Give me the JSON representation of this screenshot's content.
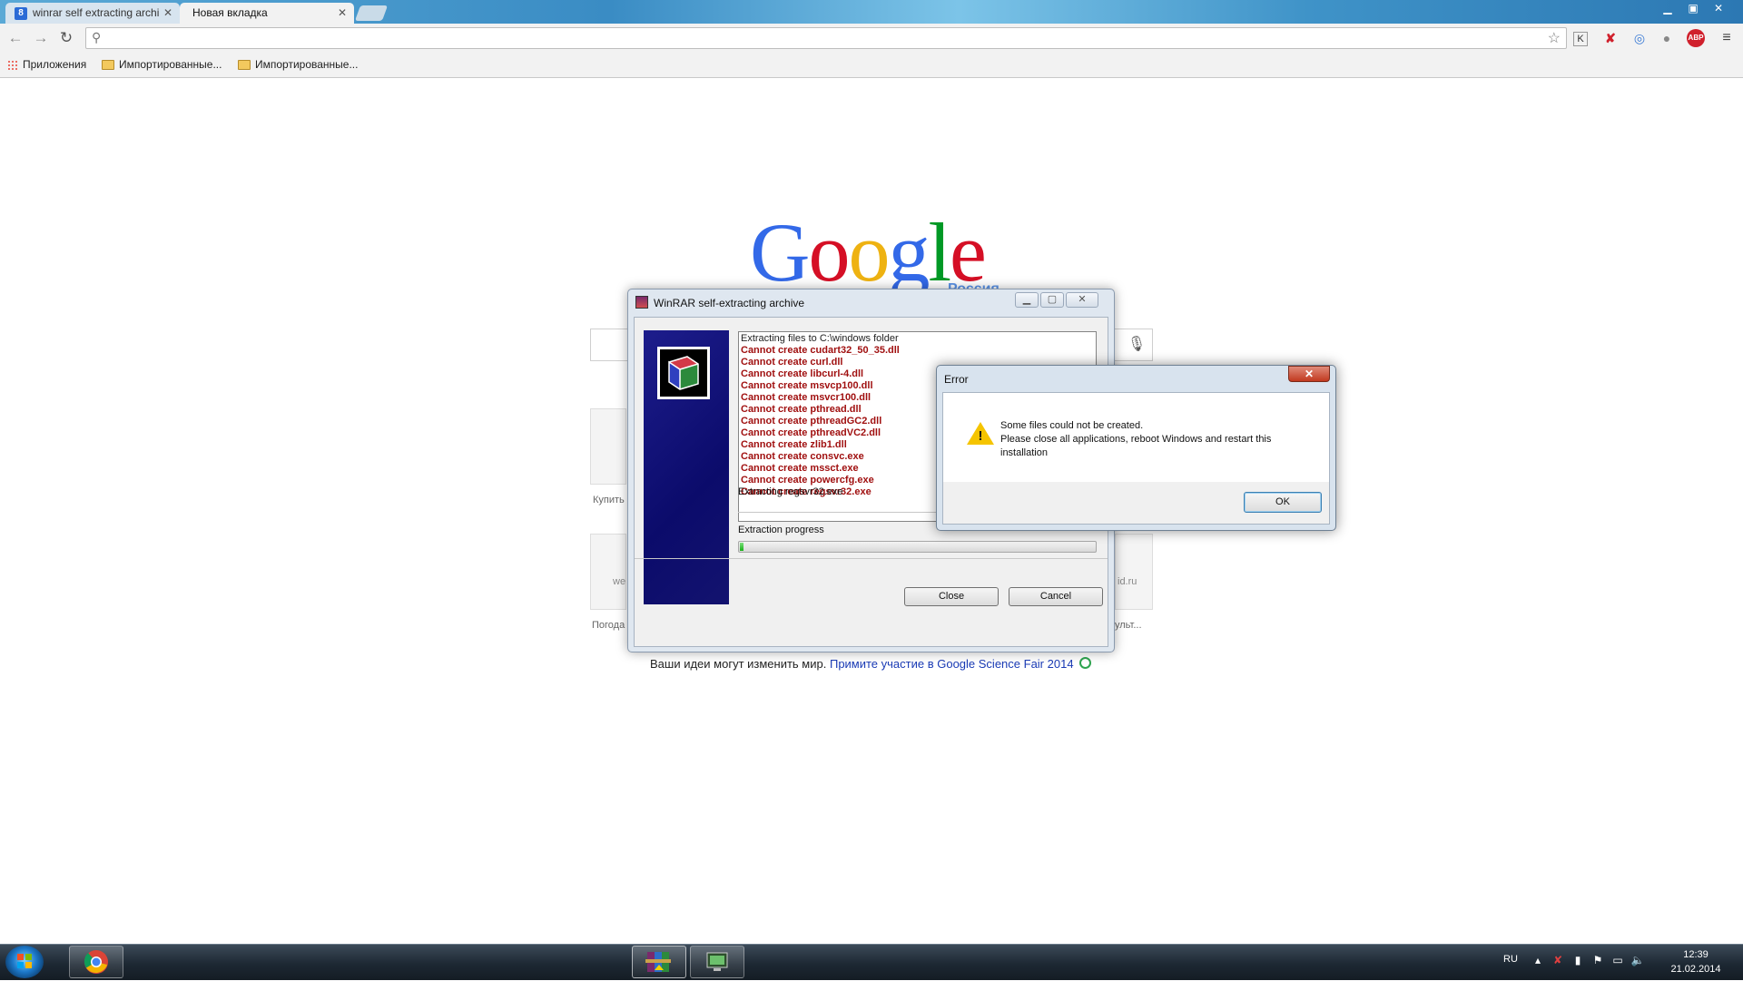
{
  "browser": {
    "tabs": [
      {
        "label": "winrar self extracting archi",
        "favicon": "8"
      },
      {
        "label": "Новая вкладка"
      }
    ],
    "bookmarks": [
      {
        "label": "Приложения"
      },
      {
        "label": "Импортированные..."
      },
      {
        "label": "Импортированные..."
      }
    ]
  },
  "google": {
    "logo_letters": [
      {
        "ch": "G",
        "color": "#3369e8"
      },
      {
        "ch": "o",
        "color": "#d50f25"
      },
      {
        "ch": "o",
        "color": "#eeb211"
      },
      {
        "ch": "g",
        "color": "#3369e8"
      },
      {
        "ch": "l",
        "color": "#009925"
      },
      {
        "ch": "e",
        "color": "#d50f25"
      }
    ],
    "region": "Россия",
    "thumb_labels": [
      "Купить",
      "Погода",
      "ульт..."
    ],
    "thumb_text": [
      "we",
      "id.ru"
    ],
    "promo_text": "Ваши идеи могут изменить мир.",
    "promo_link": "Примите участие в Google Science Fair 2014"
  },
  "winrar": {
    "title": "WinRAR self-extracting archive",
    "log_header": "Extracting files to C:\\windows folder",
    "log_errors": [
      "Cannot create cudart32_50_35.dll",
      "Cannot create curl.dll",
      "Cannot create libcurl-4.dll",
      "Cannot create msvcp100.dll",
      "Cannot create msvcr100.dll",
      "Cannot create pthread.dll",
      "Cannot create pthreadGC2.dll",
      "Cannot create pthreadVC2.dll",
      "Cannot create zlib1.dll",
      "Cannot create consvc.exe",
      "Cannot create mssct.exe",
      "Cannot create powercfg.exe",
      "Cannot create regsvr32.exe"
    ],
    "current_file": "Extracting regsvr32.exe",
    "progress_label": "Extraction progress",
    "progress_fraction": 0.01,
    "close_label": "Close",
    "cancel_label": "Cancel"
  },
  "error_dialog": {
    "title": "Error",
    "line1": "Some files could not be created.",
    "line2": "Please close all applications, reboot Windows and restart this installation",
    "ok_label": "OK",
    "close_glyph": "✕"
  },
  "taskbar": {
    "language": "RU",
    "time": "12:39",
    "date": "21.02.2014"
  }
}
